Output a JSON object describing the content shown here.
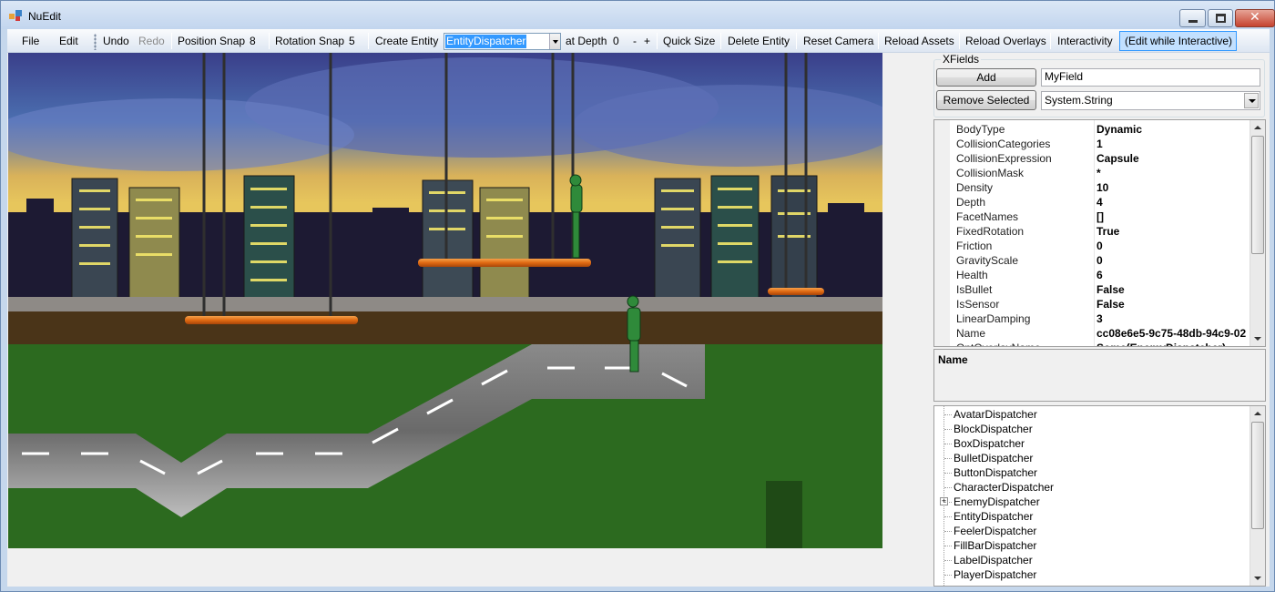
{
  "window": {
    "title": "NuEdit"
  },
  "toolbar": {
    "file": "File",
    "edit": "Edit",
    "undo": "Undo",
    "redo": "Redo",
    "position_snap_label": "Position Snap",
    "position_snap_value": "8",
    "rotation_snap_label": "Rotation Snap",
    "rotation_snap_value": "5",
    "create_entity": "Create Entity",
    "entity_dispatcher_selected": "EntityDispatcher",
    "at_depth_label": "at Depth",
    "at_depth_value": "0",
    "depth_minus": "-",
    "depth_plus": "+",
    "quick_size": "Quick Size",
    "delete_entity": "Delete Entity",
    "reset_camera": "Reset Camera",
    "reload_assets": "Reload Assets",
    "reload_overlays": "Reload Overlays",
    "interactivity": "Interactivity",
    "edit_while_interactive": "(Edit while Interactive)"
  },
  "xfields": {
    "group_label": "XFields",
    "add_button": "Add",
    "remove_button": "Remove Selected",
    "field_name_value": "MyField",
    "field_type_value": "System.String"
  },
  "properties": [
    {
      "name": "BodyType",
      "value": "Dynamic"
    },
    {
      "name": "CollisionCategories",
      "value": "1"
    },
    {
      "name": "CollisionExpression",
      "value": "Capsule"
    },
    {
      "name": "CollisionMask",
      "value": "*"
    },
    {
      "name": "Density",
      "value": "10"
    },
    {
      "name": "Depth",
      "value": "4"
    },
    {
      "name": "FacetNames",
      "value": "[]"
    },
    {
      "name": "FixedRotation",
      "value": "True"
    },
    {
      "name": "Friction",
      "value": "0"
    },
    {
      "name": "GravityScale",
      "value": "0"
    },
    {
      "name": "Health",
      "value": "6"
    },
    {
      "name": "IsBullet",
      "value": "False"
    },
    {
      "name": "IsSensor",
      "value": "False"
    },
    {
      "name": "LinearDamping",
      "value": "3"
    },
    {
      "name": "Name",
      "value": "cc08e6e5-9c75-48db-94c9-02"
    },
    {
      "name": "OptOverlayName",
      "value": "Some(EnemyDispatcher)"
    }
  ],
  "description": {
    "title": "Name"
  },
  "dispatchers": [
    {
      "label": "AvatarDispatcher",
      "expandable": false
    },
    {
      "label": "BlockDispatcher",
      "expandable": false
    },
    {
      "label": "BoxDispatcher",
      "expandable": false
    },
    {
      "label": "BulletDispatcher",
      "expandable": false
    },
    {
      "label": "ButtonDispatcher",
      "expandable": false
    },
    {
      "label": "CharacterDispatcher",
      "expandable": false
    },
    {
      "label": "EnemyDispatcher",
      "expandable": true
    },
    {
      "label": "EntityDispatcher",
      "expandable": false
    },
    {
      "label": "FeelerDispatcher",
      "expandable": false
    },
    {
      "label": "FillBarDispatcher",
      "expandable": false
    },
    {
      "label": "LabelDispatcher",
      "expandable": false
    },
    {
      "label": "PlayerDispatcher",
      "expandable": false
    }
  ],
  "colors": {
    "selection": "#3399ff",
    "platform": "#e06a12",
    "grass": "#2c6a1f",
    "road": "#6e6e6e",
    "enemy": "#2f8a3a"
  }
}
